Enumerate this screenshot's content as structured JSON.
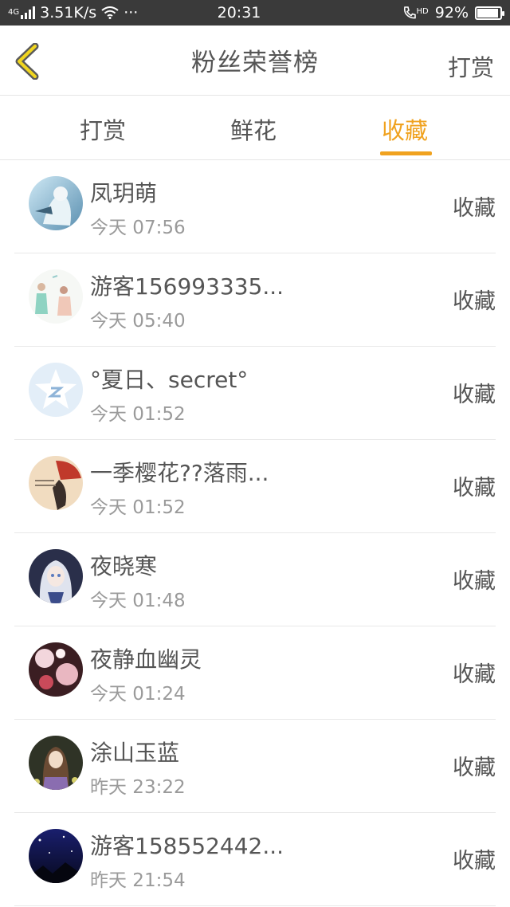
{
  "status_bar": {
    "network": "4G",
    "speed": "3.51K/s",
    "more": "···",
    "time": "20:31",
    "hd": "HD",
    "battery": "92%",
    "battery_level": 0.92
  },
  "header": {
    "title": "粉丝荣誉榜",
    "action": "打赏"
  },
  "tabs": [
    {
      "label": "打赏",
      "active": false
    },
    {
      "label": "鲜花",
      "active": false
    },
    {
      "label": "收藏",
      "active": true
    }
  ],
  "colors": {
    "accent": "#f0a21f",
    "text": "#555555",
    "subtext": "#9a9a9a",
    "statusbar": "#3a3a3a"
  },
  "fans": [
    {
      "name": "凤玥萌",
      "time": "今天 07:56",
      "action": "收藏",
      "avatar": "avatar-anime-blue"
    },
    {
      "name": "游客156993335...",
      "time": "今天 05:40",
      "action": "收藏",
      "avatar": "avatar-illustration-pastel"
    },
    {
      "name": "°夏日、secret°",
      "time": "今天 01:52",
      "action": "收藏",
      "avatar": "avatar-default-star"
    },
    {
      "name": "一季樱花??落雨...",
      "time": "今天 01:52",
      "action": "收藏",
      "avatar": "avatar-cartoon-red-hat"
    },
    {
      "name": "夜晓寒",
      "time": "今天 01:48",
      "action": "收藏",
      "avatar": "avatar-anime-white-hair"
    },
    {
      "name": "夜静血幽灵",
      "time": "今天 01:24",
      "action": "收藏",
      "avatar": "avatar-anime-flowers"
    },
    {
      "name": "涂山玉蓝",
      "time": "昨天 23:22",
      "action": "收藏",
      "avatar": "avatar-anime-girl-dark"
    },
    {
      "name": "游客158552442...",
      "time": "昨天 21:54",
      "action": "收藏",
      "avatar": "avatar-night-sky"
    }
  ]
}
